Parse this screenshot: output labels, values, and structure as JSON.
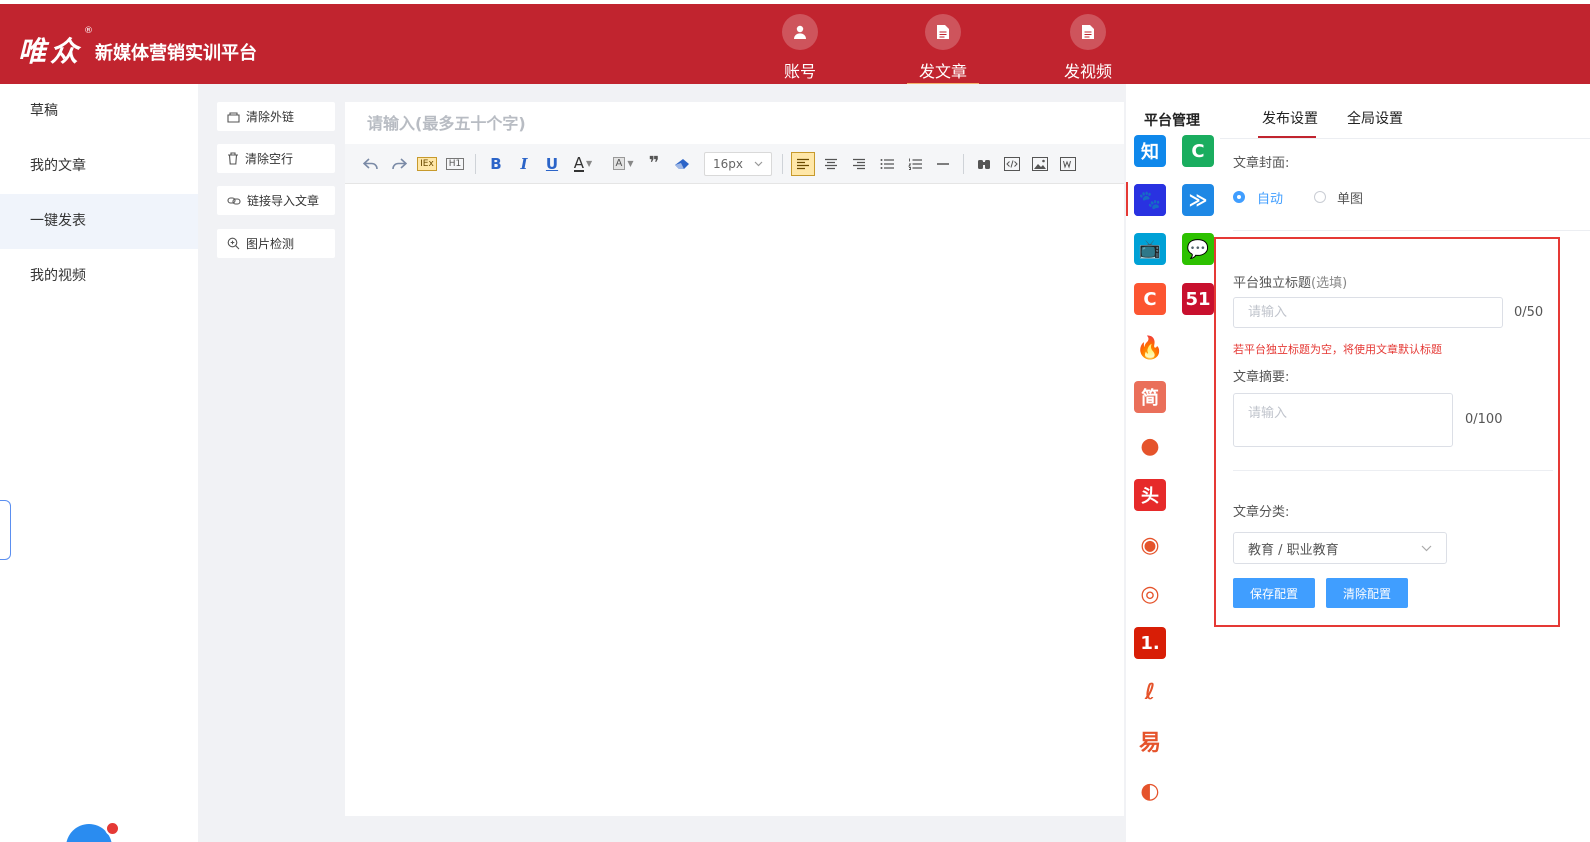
{
  "brand": {
    "logo": "唯众",
    "reg": "®",
    "title": "新媒体营销实训平台"
  },
  "nav": [
    {
      "label": "账号",
      "icon": "user-icon",
      "active": false
    },
    {
      "label": "发文章",
      "icon": "document-icon",
      "active": true
    },
    {
      "label": "发视频",
      "icon": "document-icon",
      "active": false
    }
  ],
  "sidebar": {
    "items": [
      {
        "label": "草稿",
        "active": false
      },
      {
        "label": "我的文章",
        "active": false
      },
      {
        "label": "一键发表",
        "active": true
      },
      {
        "label": "我的视频",
        "active": false
      }
    ]
  },
  "tools": [
    {
      "label": "清除外链",
      "icon": "unlink-icon"
    },
    {
      "label": "清除空行",
      "icon": "trash-icon"
    },
    {
      "label": "链接导入文章",
      "icon": "link-icon"
    },
    {
      "label": "图片检测",
      "icon": "zoom-icon"
    }
  ],
  "editor": {
    "title_placeholder": "请输入(最多五十个字)",
    "font_size": "16px",
    "toolbar_icons": [
      "undo-icon",
      "redo-icon",
      "format-text-icon",
      "h1-icon",
      "bold-icon",
      "italic-icon",
      "underline-icon",
      "font-color-icon",
      "background-color-icon",
      "quote-icon",
      "eraser-icon",
      "font-size-select",
      "align-left-icon",
      "align-center-icon",
      "align-right-icon",
      "unordered-list-icon",
      "ordered-list-icon",
      "horizontal-rule-icon",
      "search-replace-icon",
      "code-icon",
      "image-icon",
      "word-import-icon"
    ],
    "toolbar_glyphs": {
      "bold": "B",
      "italic": "I",
      "underline": "U",
      "font_color": "A",
      "h1": "H1",
      "quote": "❞",
      "format": "IEx"
    }
  },
  "platforms": {
    "header": "平台管理",
    "icons": [
      {
        "name": "zhihu-icon",
        "glyph": "知",
        "color": "#0f88eb"
      },
      {
        "name": "platform-c-icon",
        "glyph": "C",
        "color": "#1aad5f"
      },
      {
        "name": "baidu-icon",
        "glyph": "🐾",
        "color": "#2932e1"
      },
      {
        "name": "stack-icon",
        "glyph": "≫",
        "color": "#1e88e5"
      },
      {
        "name": "bilibili-icon",
        "glyph": "📺",
        "color": "#00a1d6"
      },
      {
        "name": "wechat-icon",
        "glyph": "💬",
        "color": "#2dc100"
      },
      {
        "name": "csdn-icon",
        "glyph": "C",
        "color": "#fc5531"
      },
      {
        "name": "51cto-icon",
        "glyph": "51",
        "color": "#c8102e"
      },
      {
        "name": "flame-icon",
        "glyph": "🔥",
        "color": "#ffffff"
      },
      {
        "name": "jianshu-icon",
        "glyph": "简",
        "color": "#ea6f5a"
      },
      {
        "name": "sohu-icon",
        "glyph": "●",
        "color": "#ffffff"
      },
      {
        "name": "toutiao-icon",
        "glyph": "头",
        "color": "#e62a2a"
      },
      {
        "name": "weibo-icon",
        "glyph": "◉",
        "color": "#ffffff"
      },
      {
        "name": "circle-logo-icon",
        "glyph": "◎",
        "color": "#ffffff"
      },
      {
        "name": "yidian-icon",
        "glyph": "1.",
        "color": "#d81e06"
      },
      {
        "name": "brush-logo-icon",
        "glyph": "ℓ",
        "color": "#ffffff"
      },
      {
        "name": "netease-icon",
        "glyph": "易",
        "color": "#ffffff"
      },
      {
        "name": "spiral-logo-icon",
        "glyph": "◐",
        "color": "#ffffff"
      }
    ]
  },
  "settings": {
    "tabs": [
      {
        "label": "发布设置",
        "active": true
      },
      {
        "label": "全局设置",
        "active": false
      }
    ],
    "cover_label": "文章封面:",
    "cover_options": [
      {
        "label": "自动",
        "checked": true
      },
      {
        "label": "单图",
        "checked": false
      }
    ],
    "platform_title_label": "平台独立标题",
    "platform_title_optional": "(选填)",
    "platform_title_placeholder": "请输入",
    "platform_title_count": "0/50",
    "platform_title_hint": "若平台独立标题为空，将使用文章默认标题",
    "summary_label": "文章摘要:",
    "summary_placeholder": "请输入",
    "summary_count": "0/100",
    "category_label": "文章分类:",
    "category_value": "教育 / 职业教育",
    "save_button": "保存配置",
    "clear_button": "清除配置"
  },
  "colors": {
    "brand_red": "#c1242f",
    "accent_blue": "#409eff",
    "highlight_red": "#e53935"
  }
}
